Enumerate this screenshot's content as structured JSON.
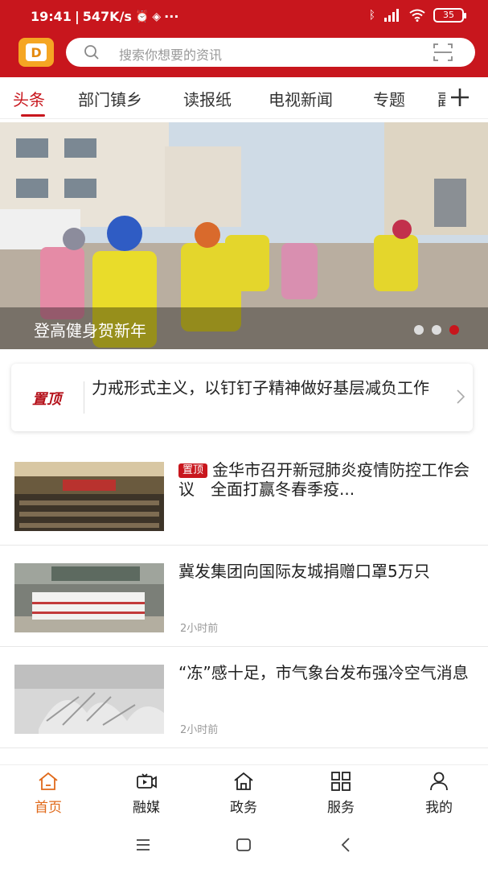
{
  "status_bar": {
    "time": "19:41",
    "speed": "547K/s",
    "battery": "35"
  },
  "search": {
    "placeholder": "搜索你想要的资讯"
  },
  "tabs": [
    {
      "label": "头条",
      "active": true
    },
    {
      "label": "部门镇乡"
    },
    {
      "label": "读报纸"
    },
    {
      "label": "电视新闻"
    },
    {
      "label": "专题"
    },
    {
      "label": "副"
    }
  ],
  "banner": {
    "caption": "登高健身贺新年",
    "dots": 3,
    "active_dot": 3
  },
  "pinned": {
    "label": "置顶",
    "text": "力戒形式主义，以钉钉子精神做好基层减负工作"
  },
  "news": [
    {
      "tag": "置顶",
      "title": "金华市召开新冠肺炎疫情防控工作会议　全面打赢冬春季疫...",
      "time": "",
      "thumb": "meeting-photo"
    },
    {
      "tag": "",
      "title": "冀发集团向国际友城捐赠口罩5万只",
      "time": "2小时前",
      "thumb": "donation-photo"
    },
    {
      "tag": "",
      "title": "“冻”感十足，市气象台发布强冷空气消息",
      "time": "2小时前",
      "thumb": "frost-photo"
    }
  ],
  "bottom_nav": [
    {
      "label": "首页",
      "icon": "home-icon",
      "active": true
    },
    {
      "label": "融媒",
      "icon": "media-tv-icon"
    },
    {
      "label": "政务",
      "icon": "government-icon"
    },
    {
      "label": "服务",
      "icon": "grid-icon"
    },
    {
      "label": "我的",
      "icon": "user-icon"
    }
  ],
  "colors": {
    "brand_red": "#c8161d",
    "nav_active": "#e06a1b"
  }
}
